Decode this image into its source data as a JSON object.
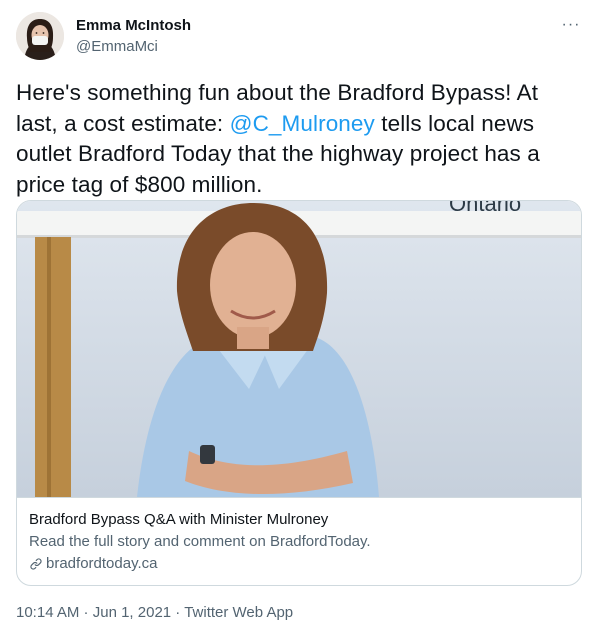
{
  "author": {
    "name": "Emma McIntosh",
    "handle": "@EmmaMci",
    "avatar_icon": "avatar-photo"
  },
  "menu": {
    "icon": "more-options-icon",
    "glyph": "···"
  },
  "tweet": {
    "text_before": "Here's something fun about the Bradford Bypass! At last, a cost estimate: ",
    "mention": "@C_Mulroney",
    "text_after": " tells local news outlet Bradford Today that the highway project has a price tag of $800 million."
  },
  "card": {
    "image_icon": "article-photo",
    "sign_text": "Ontario",
    "title": "Bradford Bypass Q&A with Minister Mulroney",
    "description": "Read the full story and comment on BradfordToday.",
    "domain": "bradfordtoday.ca",
    "domain_icon": "link-icon"
  },
  "meta": {
    "time": "10:14 AM",
    "sep1": " · ",
    "date": "Jun 1, 2021",
    "sep2": " · ",
    "source": "Twitter Web App"
  },
  "colors": {
    "link": "#1d9bf0",
    "secondary_text": "#536471",
    "border": "#cfd9de"
  }
}
